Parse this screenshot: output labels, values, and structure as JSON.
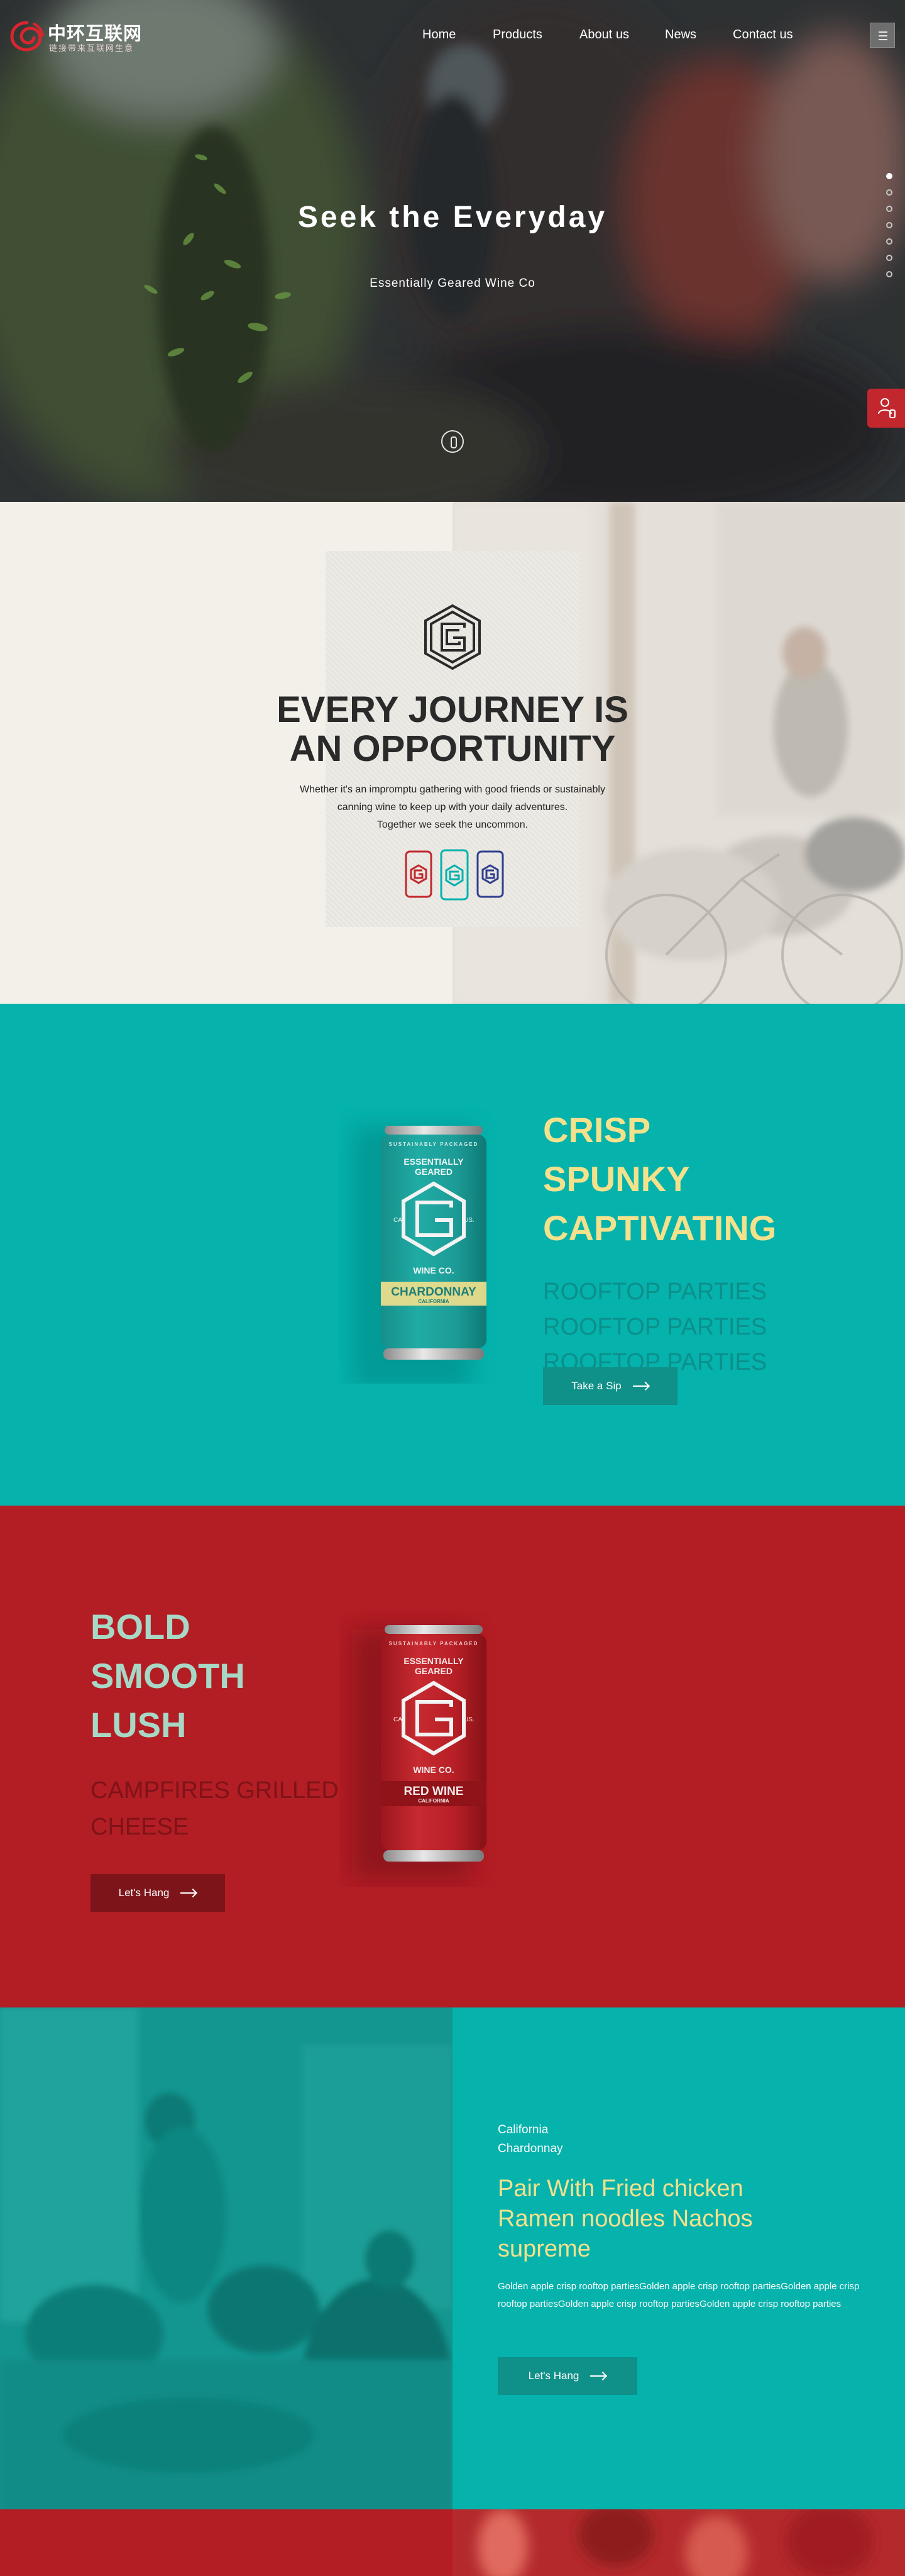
{
  "brand": {
    "title": "中环互联网",
    "subtitle": "链接带来互联网生意"
  },
  "nav": {
    "items": [
      {
        "label": "Home"
      },
      {
        "label": "Products"
      },
      {
        "label": "About us"
      },
      {
        "label": "News"
      },
      {
        "label": "Contact us"
      }
    ],
    "menu_icon": "hamburger-icon"
  },
  "hero": {
    "title": "Seek the Everyday",
    "subtitle": "Essentially Geared Wine Co",
    "slide_count": 7,
    "active_slide": 1,
    "scroll_icon": "mouse-scroll-icon",
    "contact_icon": "person-phone-icon"
  },
  "journey": {
    "title_line1": "EVERY JOURNEY IS",
    "title_line2": "AN OPPORTUNITY",
    "text_line1": "Whether it's an impromptu gathering with good friends or sustainably",
    "text_line2": "canning wine to keep up with your daily adventures.",
    "text_line3": "Together we seek the uncommon.",
    "logo_icon": "g-hexagon-logo-icon",
    "can_icons": [
      "red-can-icon",
      "teal-can-icon",
      "blue-can-icon"
    ]
  },
  "crisp": {
    "heading": [
      "CRISP",
      "SPUNKY",
      "CAPTIVATING"
    ],
    "sub": "ROOFTOP PARTIES ROOFTOP PARTIES ROOFTOP PARTIES",
    "button": "Take a Sip",
    "can": {
      "top_text": "SUSTAINABLY PACKAGED",
      "brand_line1": "ESSENTIALLY",
      "brand_line2": "GEARED",
      "left": "CA.",
      "right": "US.",
      "company": "WINE CO.",
      "varietal": "CHARDONNAY",
      "region": "CALIFORNIA"
    }
  },
  "bold": {
    "heading": [
      "BOLD",
      "SMOOTH",
      "LUSH"
    ],
    "sub": "CAMPFIRES GRILLED CHEESE",
    "button": "Let's Hang",
    "can": {
      "top_text": "SUSTAINABLY PACKAGED",
      "brand_line1": "ESSENTIALLY",
      "brand_line2": "GEARED",
      "left": "CA.",
      "right": "US.",
      "company": "WINE CO.",
      "varietal": "RED WINE",
      "region": "CALIFORNIA"
    }
  },
  "pair": {
    "label1": "California",
    "label2": "Chardonnay",
    "title": "Pair With Fried chicken Ramen noodles Nachos supreme",
    "text": "Golden apple crisp rooftop partiesGolden apple crisp rooftop partiesGolden apple crisp rooftop partiesGolden apple crisp rooftop partiesGolden apple crisp rooftop parties",
    "button": "Let's Hang"
  },
  "colors": {
    "teal": "#05b2ac",
    "red": "#b31d24",
    "yellow": "#f4e18c",
    "mint": "#a7d8c6",
    "dark": "#2a2a2a"
  }
}
